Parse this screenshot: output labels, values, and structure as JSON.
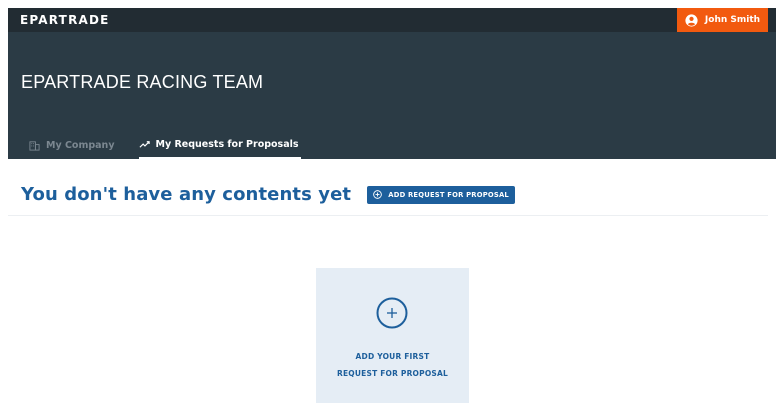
{
  "topbar": {
    "logo_text": "EPARTRADE",
    "user_name": "John Smith",
    "user_icon": "user-circle-icon"
  },
  "header": {
    "title": "EPARTRADE RACING TEAM",
    "tabs": [
      {
        "label": "My Company",
        "icon": "building-icon",
        "active": false
      },
      {
        "label": "My Requests for Proposals",
        "icon": "trend-line-icon",
        "active": true
      }
    ]
  },
  "content": {
    "empty_title": "You don't have any contents yet",
    "add_button_label": "ADD REQUEST FOR PROPOSAL",
    "add_button_icon": "plus-circle-icon"
  },
  "card": {
    "line1": "ADD YOUR FIRST",
    "line2": "REQUEST FOR PROPOSAL",
    "icon": "plus-circle-icon"
  },
  "colors": {
    "topbar_bg": "#222c33",
    "header_bg": "#2b3b45",
    "accent_orange": "#f25a0f",
    "primary_blue": "#1d5f9c",
    "card_bg": "#e5edf5"
  }
}
